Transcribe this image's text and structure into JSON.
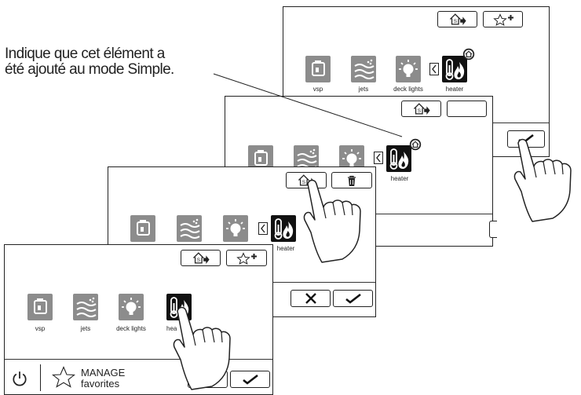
{
  "annotation": {
    "line1": "Indique que cet élément a",
    "line2": "été ajouté au mode Simple."
  },
  "labels": {
    "vsp": "vsp",
    "jets": "jets",
    "deck_lights": "deck lights",
    "heater": "heater",
    "heater_partial": "hea"
  },
  "footer": {
    "manage": "MANAGE",
    "favorites": "favorites"
  },
  "icons": {
    "simple_mode": "house-arrow-icon",
    "add_favorite": "star-plus-icon",
    "delete": "trash-icon",
    "cancel": "x-icon",
    "confirm": "check-icon",
    "power": "power-icon",
    "favorites": "star-outline-icon"
  },
  "colors": {
    "tile_gray": "#8c8c8c",
    "tile_dark": "#111111",
    "outline": "#222222"
  }
}
